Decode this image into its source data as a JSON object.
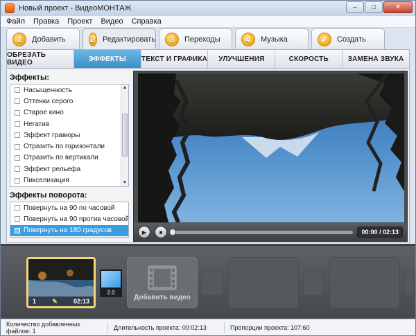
{
  "window": {
    "title": "Новый проект - ВидеоМОНТАЖ",
    "minimize": "–",
    "maximize": "□",
    "close": "✕"
  },
  "menu": [
    "Файл",
    "Правка",
    "Проект",
    "Видео",
    "Справка"
  ],
  "steps": [
    {
      "num": "1",
      "label": "Добавить",
      "active": false
    },
    {
      "num": "2",
      "label": "Редактировать",
      "active": true
    },
    {
      "num": "3",
      "label": "Переходы",
      "active": false
    },
    {
      "num": "4",
      "label": "Музыка",
      "active": false
    },
    {
      "num": "✓",
      "label": "Создать",
      "active": false
    }
  ],
  "subtabs": [
    "ОБРЕЗАТЬ ВИДЕО",
    "ЭФФЕКТЫ",
    "ТЕКСТ И ГРАФИКА",
    "УЛУЧШЕНИЯ",
    "СКОРОСТЬ",
    "ЗАМЕНА ЗВУКА"
  ],
  "effects": {
    "title": "Эффекты:",
    "items": [
      "Насыщенность",
      "Оттенки серого",
      "Старое кино",
      "Негатив",
      "Эффект гравюры",
      "Отразить по горизонтали",
      "Отразить по вертикали",
      "Эффект рельефа",
      "Пикселизация"
    ]
  },
  "rotation": {
    "title": "Эффекты поворота:",
    "items": [
      "Повернуть на 90 по часовой",
      "Повернуть на 90 против часовой",
      "Повернуть на 180 градусов"
    ],
    "selected": 2
  },
  "player": {
    "time": "00:00 / 02:13",
    "play_icon": "▶",
    "stop_icon": "■",
    "progress": 0
  },
  "storyboard": {
    "clip_index": "1",
    "clip_duration": "02:13",
    "transition_duration": "2.0",
    "add_video_label": "Добавить видео"
  },
  "status": {
    "files": "Количество добавленных файлов: 1",
    "duration": "Длительность проекта: 00:02:13",
    "aspect": "Пропорции проекта: 107:60"
  },
  "colors": {
    "accent": "#3b9de1",
    "step_badge": "#f0a81a",
    "active_subtab": "#4a9fd4",
    "clip_border": "#f5d67a"
  }
}
